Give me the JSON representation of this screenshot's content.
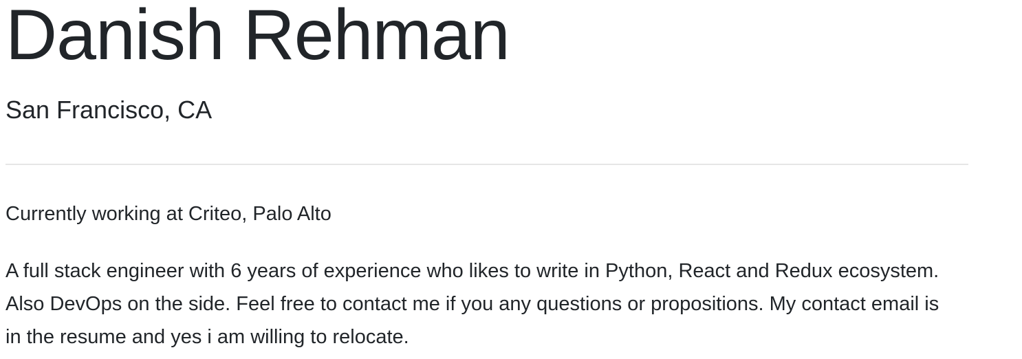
{
  "profile": {
    "name": "Danish Rehman",
    "location": "San Francisco, CA",
    "current_position": "Currently working at Criteo, Palo Alto",
    "bio": "A full stack engineer with 6 years of experience who likes to write in Python, React and Redux ecosystem. Also DevOps on the side. Feel free to contact me if you any questions or propositions. My contact email is in the resume and yes i am willing to relocate."
  },
  "colors": {
    "text": "#212529",
    "divider": "#e6e6e6",
    "background": "#ffffff"
  }
}
